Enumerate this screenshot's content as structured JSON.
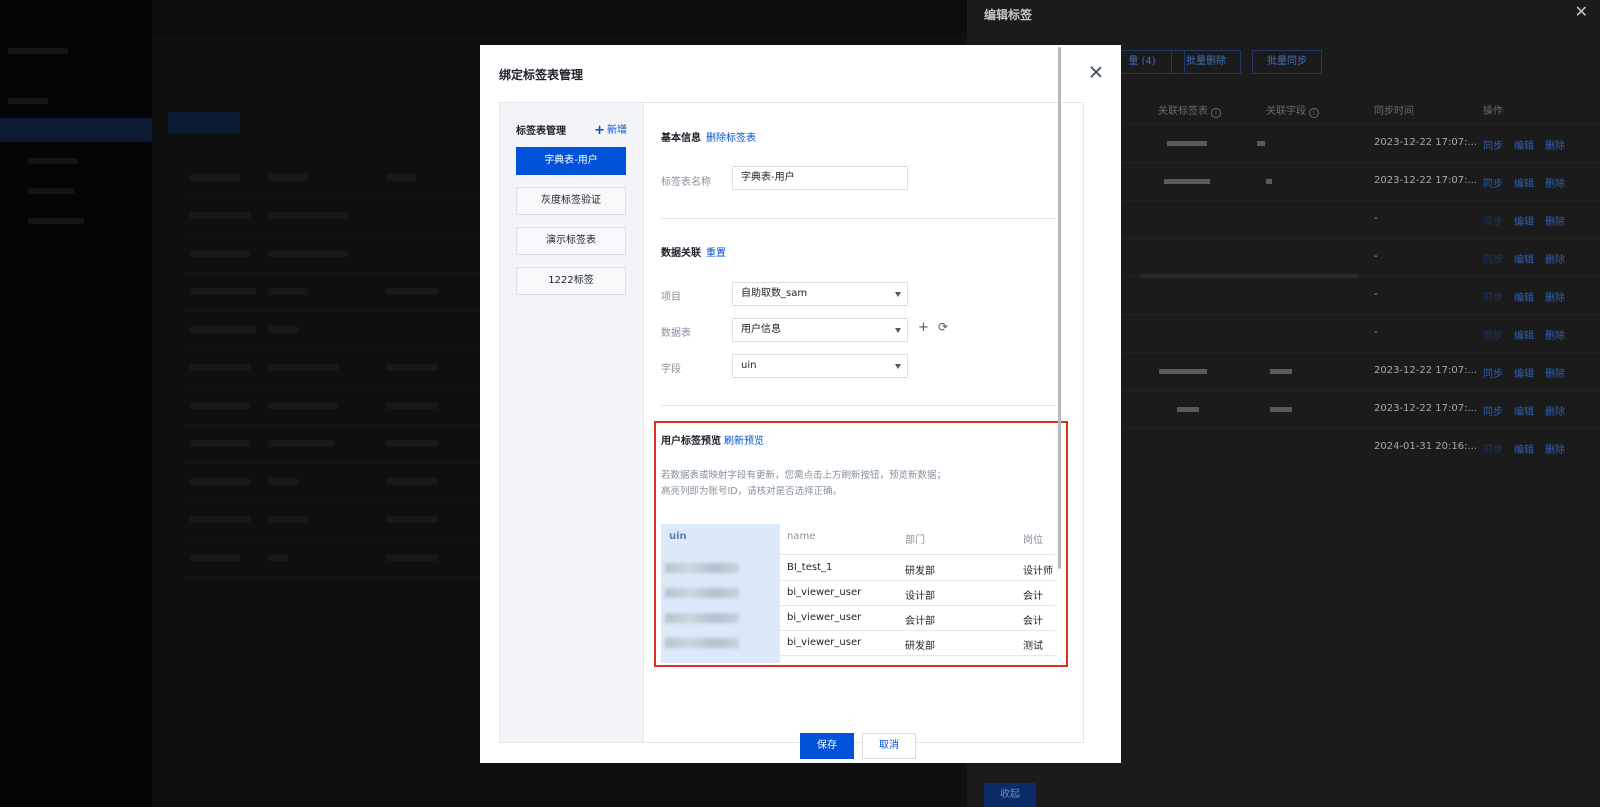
{
  "drawer": {
    "title": "编辑标签",
    "buttons": [
      "量 (4)",
      "批量删除",
      "批量同步"
    ],
    "headers": {
      "bound_table": "关联标签表",
      "bound_field": "关联字段",
      "sync_time": "同步时间",
      "ops": "操作"
    },
    "rows": [
      {
        "time": "2023-12-22 17:07:...",
        "sync": "同步",
        "edit": "编辑",
        "del": "删除",
        "sync_enabled": true
      },
      {
        "time": "2023-12-22 17:07:...",
        "sync": "同步",
        "edit": "编辑",
        "del": "删除",
        "sync_enabled": true
      },
      {
        "time": "-",
        "sync": "同步",
        "edit": "编辑",
        "del": "删除",
        "sync_enabled": false
      },
      {
        "time": "-",
        "sync": "同步",
        "edit": "编辑",
        "del": "删除",
        "sync_enabled": false
      },
      {
        "time": "-",
        "sync": "同步",
        "edit": "编辑",
        "del": "删除",
        "sync_enabled": false
      },
      {
        "time": "-",
        "sync": "同步",
        "edit": "编辑",
        "del": "删除",
        "sync_enabled": false
      },
      {
        "time": "2023-12-22 17:07:...",
        "sync": "同步",
        "edit": "编辑",
        "del": "删除",
        "sync_enabled": true
      },
      {
        "time": "2023-12-22 17:07:...",
        "sync": "同步",
        "edit": "编辑",
        "del": "删除",
        "sync_enabled": true
      },
      {
        "time": "2024-01-31 20:16:...",
        "sync": "同步",
        "edit": "编辑",
        "del": "删除",
        "sync_enabled": false
      }
    ],
    "collapse_label": "收起"
  },
  "modal": {
    "title": "绑定标签表管理",
    "sidebar": {
      "heading": "标签表管理",
      "add_label": "新增",
      "items": [
        "字典表-用户",
        "灰度标签验证",
        "演示标签表",
        "1222标签"
      ],
      "active_index": 0
    },
    "basic": {
      "title": "基本信息",
      "delete_link": "删除标签表",
      "name_label": "标签表名称",
      "name_value": "字典表-用户"
    },
    "association": {
      "title": "数据关联",
      "reset_link": "重置",
      "project_label": "项目",
      "project_value": "自助取数_sam",
      "table_label": "数据表",
      "table_value": "用户信息",
      "field_label": "字段",
      "field_value": "uin"
    },
    "preview": {
      "title": "用户标签预览",
      "refresh_link": "刷新预览",
      "hint": "若数据表或映射字段有更新，您需点击上方刷新按钮，预览新数据；\n高亮列即为账号ID，请核对是否选择正确。",
      "columns": [
        "uin",
        "name",
        "部门",
        "岗位"
      ],
      "rows": [
        [
          "",
          "BI_test_1",
          "研发部",
          "设计师"
        ],
        [
          "",
          "bi_viewer_user",
          "设计部",
          "会计"
        ],
        [
          "",
          "bi_viewer_user",
          "会计部",
          "会计"
        ],
        [
          "",
          "bi_viewer_user",
          "研发部",
          "测试"
        ]
      ]
    },
    "save_label": "保存",
    "cancel_label": "取消"
  }
}
